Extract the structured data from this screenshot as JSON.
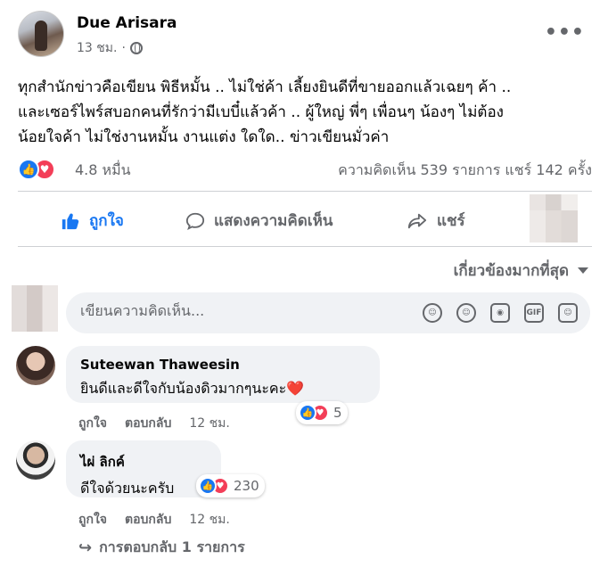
{
  "post": {
    "author": "Due Arisara",
    "time": "13 ชม.",
    "dot": "·",
    "text_lines": [
      "ทุกสำนักข่าวคือเขียน พิธีหมั้น .. ไม่ใช่ค้า เลี้ยงยินดีที่ขายออกแล้วเฉยๆ ค้า ..",
      "และเซอร์ไพร์สบอกคนที่รักว่ามีเบบี๋แล้วค้า .. ผู้ใหญ่ พี่ๆ เพื่อนๆ น้องๆ ไม่ต้อง",
      "น้อยใจค้า ไม่ใช่งานหมั้น งานแต่ง ใดใด.. ข่าวเขียนมั่วค่า"
    ],
    "reaction_count": "4.8 หมื่น",
    "stats": "ความคิดเห็น 539 รายการ  แชร์ 142 ครั้ง",
    "actions": {
      "like": "ถูกใจ",
      "comment": "แสดงความคิดเห็น",
      "share": "แชร์"
    }
  },
  "sort_label": "เกี่ยวข้องมากที่สุด",
  "comment_input": {
    "placeholder": "เขียนความคิดเห็น..."
  },
  "comments": [
    {
      "name": "Suteewan Thaweesin",
      "text": "ยินดีและดีใจกับน้องดิวมากๆนะคะ❤️",
      "reactions": "5",
      "like": "ถูกใจ",
      "reply": "ตอบกลับ",
      "time": "12 ชม."
    },
    {
      "name": "ไผ่ ลิกค์",
      "text": "ดีใจด้วยนะครับ",
      "reactions": "230",
      "like": "ถูกใจ",
      "reply": "ตอบกลับ",
      "time": "12 ชม."
    }
  ],
  "replies_label": "การตอบกลับ 1 รายการ",
  "icons": {
    "globe": "globe-icon",
    "more": "more-options-icon",
    "like": "thumbs-up-icon",
    "love": "heart-icon",
    "comment": "comment-bubble-icon",
    "share": "share-arrow-icon",
    "caret": "caret-down-icon",
    "sticker": "sticker-icon",
    "emoji": "emoji-icon",
    "camera": "camera-icon",
    "gif": "gif-icon",
    "avatar_sticker": "avatar-sticker-icon",
    "reply": "reply-arrow-icon"
  },
  "colors": {
    "accent": "#1877f2",
    "love": "#f33e58",
    "muted": "#65676b",
    "bubble": "#f0f2f5"
  }
}
